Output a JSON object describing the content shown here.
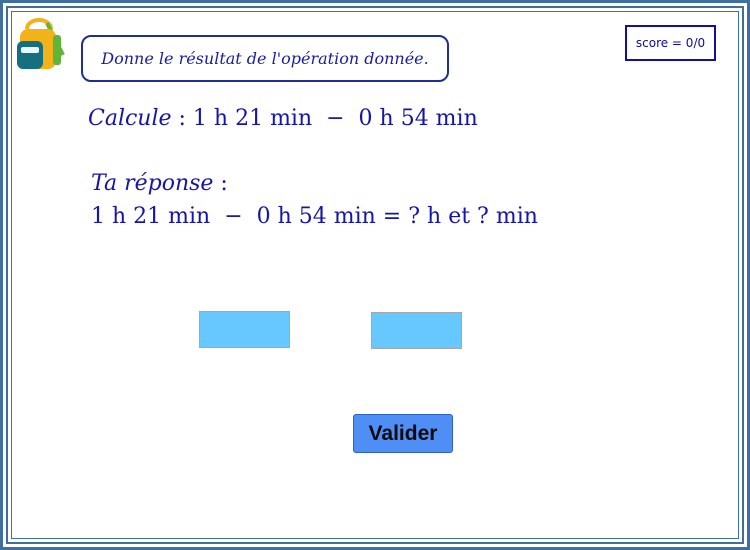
{
  "instruction": "Donne le résultat de l'opération donnée.",
  "score": {
    "label": "score = 0/0"
  },
  "question": {
    "calc_word": "Calcule",
    "rest": " : 1 h 21 min  −  0 h 54 min"
  },
  "answer": {
    "label_word": "Ta réponse",
    "label_colon": " :",
    "equation": "1 h 21 min  −  0 h 54 min = ? h et ? min"
  },
  "inputs": {
    "hours_value": "",
    "minutes_value": ""
  },
  "buttons": {
    "validate_label": "Valider"
  },
  "icons": {
    "logo": "school-backpack-icon"
  },
  "colors": {
    "text_blue": "#1515a8",
    "input_fill": "#66c8ff",
    "button_fill": "#4f8ff5",
    "frame": "#3f6f9f"
  }
}
